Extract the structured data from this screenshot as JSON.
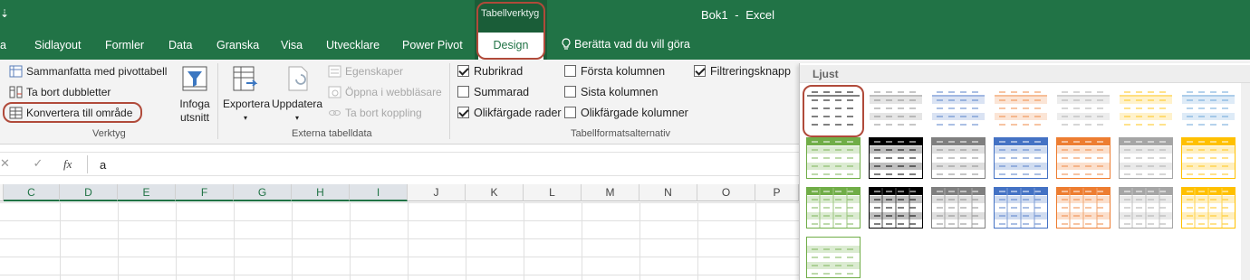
{
  "window": {
    "qat_glyph": "⇣",
    "doc_name": "Bok1",
    "separator": "-",
    "app_name": "Excel",
    "context_label": "Tabellverktyg"
  },
  "tabs": [
    {
      "label": "a"
    },
    {
      "label": "Sidlayout"
    },
    {
      "label": "Formler"
    },
    {
      "label": "Data"
    },
    {
      "label": "Granska"
    },
    {
      "label": "Visa"
    },
    {
      "label": "Utvecklare"
    },
    {
      "label": "Power Pivot"
    }
  ],
  "active_tab": "Design",
  "tell_me": "Berätta vad du vill göra",
  "ribbon": {
    "verktyg": {
      "label": "Verktyg",
      "summarize": "Sammanfatta med pivottabell",
      "remove_duplicates": "Ta bort dubbletter",
      "convert": "Konvertera till område",
      "slicer_line1": "Infoga",
      "slicer_line2": "utsnitt"
    },
    "externa": {
      "label": "Externa tabelldata",
      "export": "Exportera",
      "refresh": "Uppdatera",
      "properties": "Egenskaper",
      "open_browser": "Öppna i webbläsare",
      "unlink": "Ta bort koppling"
    },
    "options": {
      "label": "Tabellformatsalternativ",
      "header_row": {
        "label": "Rubrikrad",
        "checked": true
      },
      "total_row": {
        "label": "Summarad",
        "checked": false
      },
      "banded_rows": {
        "label": "Olikfärgade rader",
        "checked": true
      },
      "first_column": {
        "label": "Första kolumnen",
        "checked": false
      },
      "last_column": {
        "label": "Sista kolumnen",
        "checked": false
      },
      "banded_columns": {
        "label": "Olikfärgade kolumner",
        "checked": false
      },
      "filter_button": {
        "label": "Filtreringsknapp",
        "checked": true
      }
    }
  },
  "formula_bar": {
    "cancel": "✕",
    "enter": "✓",
    "fx": "fx",
    "value": "a"
  },
  "columns": [
    "C",
    "D",
    "E",
    "F",
    "G",
    "H",
    "I",
    "J",
    "K",
    "L",
    "M",
    "N",
    "O",
    "P"
  ],
  "selected_columns": [
    "C",
    "D",
    "E",
    "F",
    "G",
    "H",
    "I"
  ],
  "gallery": {
    "section": "Ljust",
    "colors": [
      "#000000",
      "#7f7f7f",
      "#4472c4",
      "#ed7d31",
      "#a5a5a5",
      "#ffc000",
      "#5b9bd5",
      "#70ad47"
    ]
  },
  "colors": {
    "excel_green": "#217346",
    "highlight": "#b04a3a"
  }
}
